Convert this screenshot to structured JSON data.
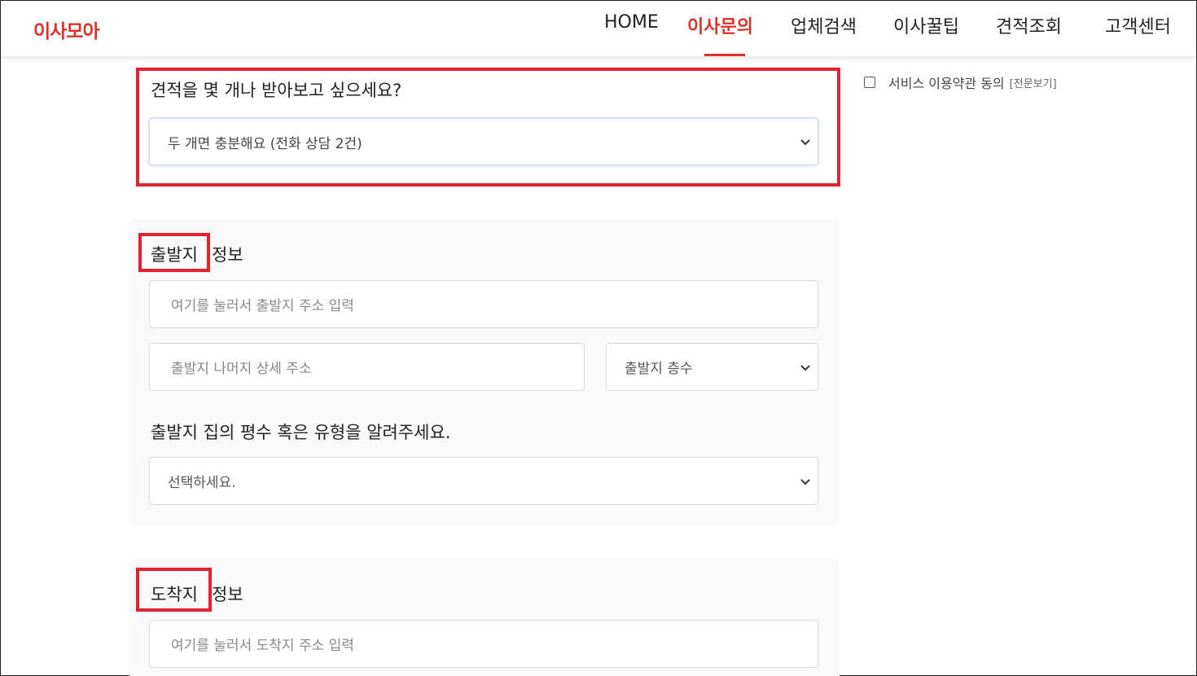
{
  "header": {
    "logo": "이사모아",
    "nav": [
      {
        "label": "HOME"
      },
      {
        "label": "이사문의"
      },
      {
        "label": "업체검색"
      },
      {
        "label": "이사꿀팁"
      },
      {
        "label": "견적조회"
      },
      {
        "label": "고객센터"
      }
    ],
    "active_index": 1
  },
  "quote": {
    "question": "견적을 몇 개나 받아보고 싶으세요?",
    "selected": "두 개면 충분해요 (전화 상담 2건)"
  },
  "departure": {
    "title_highlight": "출발지",
    "title_rest": "정보",
    "address_placeholder": "여기를 눌러서 출발지 주소 입력",
    "detail_placeholder": "출발지 나머지 상세 주소",
    "floor_selected": "출발지 층수",
    "size_question": "출발지 집의 평수 혹은 유형을 알려주세요.",
    "size_selected": "선택하세요."
  },
  "arrival": {
    "title_highlight": "도착지",
    "title_rest": "정보",
    "address_placeholder": "여기를 눌러서 도착지 주소 입력"
  },
  "terms": {
    "label": "서비스 이용약관 동의",
    "link": "[전문보기]"
  },
  "colors": {
    "brand": "#d9332c",
    "highlight_box": "#e02231"
  }
}
